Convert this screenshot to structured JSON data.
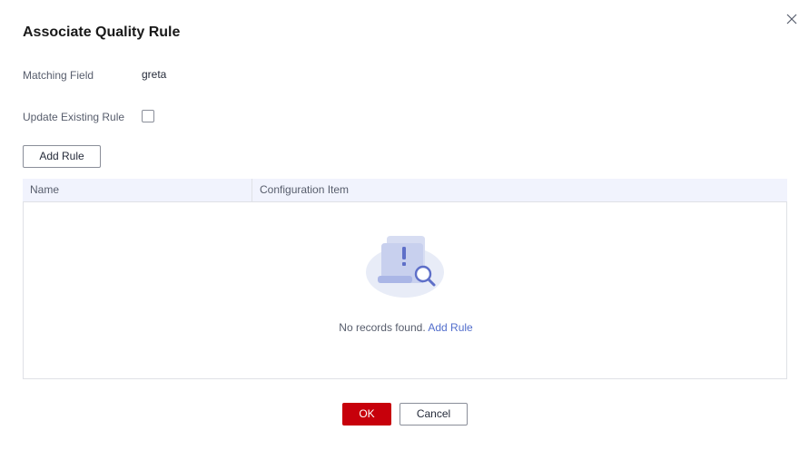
{
  "dialog": {
    "title": "Associate Quality Rule",
    "close_icon": "close-icon"
  },
  "form": {
    "matching_field_label": "Matching Field",
    "matching_field_value": "greta",
    "update_existing_label": "Update Existing Rule",
    "update_existing_checked": false
  },
  "toolbar": {
    "add_rule_label": "Add Rule"
  },
  "table": {
    "columns": [
      "Name",
      "Configuration Item"
    ],
    "rows": [],
    "empty": {
      "icon": "no-records-illustration-icon",
      "message": "No records found.",
      "link_label": "Add Rule"
    }
  },
  "footer": {
    "ok_label": "OK",
    "cancel_label": "Cancel"
  },
  "colors": {
    "primary": "#c7000b",
    "link": "#526ecc",
    "header_bg": "#f1f3fd",
    "border": "#dfe1e6"
  }
}
